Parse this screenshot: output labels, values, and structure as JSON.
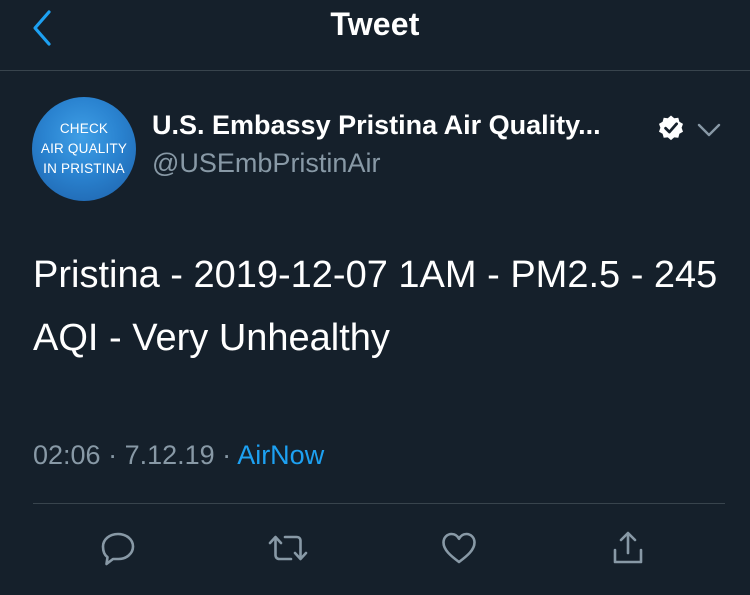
{
  "nav": {
    "title": "Tweet"
  },
  "profile": {
    "avatar_lines": [
      "CHECK",
      "AIR QUALITY",
      "IN PRISTINA"
    ],
    "display_name": "U.S. Embassy Pristina Air Quality...",
    "handle": "@USEmbPristinAir",
    "verified": true
  },
  "tweet": {
    "text": "Pristina - 2019-12-07 1AM - PM2.5 - 245 AQI - Very Unhealthy",
    "time": "02:06",
    "sep1": " · ",
    "date": "7.12.19",
    "sep2": " · ",
    "source": "AirNow"
  },
  "actions": [
    {
      "name": "reply",
      "icon": "reply-icon"
    },
    {
      "name": "retweet",
      "icon": "retweet-icon"
    },
    {
      "name": "like",
      "icon": "heart-icon"
    },
    {
      "name": "share",
      "icon": "share-icon"
    }
  ],
  "colors": {
    "background": "#15202b",
    "accent": "#1da1f2",
    "secondary_text": "#8899a6",
    "divider": "#38444d"
  }
}
